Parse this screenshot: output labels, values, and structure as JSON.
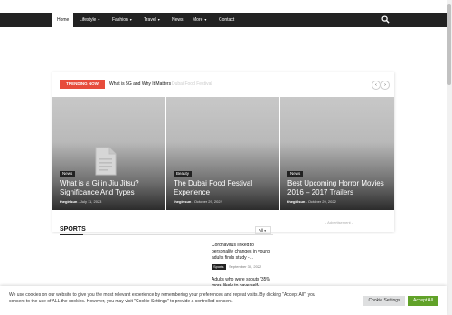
{
  "nav": {
    "items": [
      {
        "label": "Home",
        "caret": ""
      },
      {
        "label": "Lifestyle",
        "caret": "▾"
      },
      {
        "label": "Fashion",
        "caret": "▾"
      },
      {
        "label": "Travel",
        "caret": "▾"
      },
      {
        "label": "News",
        "caret": ""
      },
      {
        "label": "More",
        "caret": "▾"
      },
      {
        "label": "Contact",
        "caret": ""
      }
    ],
    "search_icon": "search-icon"
  },
  "trending": {
    "label": "TRENDING NOW",
    "headline": "What is 5G and Why It Matters",
    "fading": "Dubai Food Festival",
    "prev": "‹",
    "next": "›"
  },
  "slides": [
    {
      "category": "News",
      "title": "What is a Gi in Jiu Jitsu? Significance And Types",
      "author": "thegirlsun",
      "date": "July 11, 2023"
    },
    {
      "category": "Beauty",
      "title": "The Dubai Food Festival Experience",
      "author": "thegirlsun",
      "date": "October 29, 2022"
    },
    {
      "category": "News",
      "title": "Best Upcoming Horror Movies 2016 – 2017 Trailers",
      "author": "thegirlsun",
      "date": "October 29, 2022"
    }
  ],
  "sports": {
    "title": "SPORTS",
    "filter": "All",
    "advertisement": "- Advertisement -",
    "items": [
      {
        "title": "Coronavirus linked to personality changes in young adults finds study -...",
        "category": "Sports",
        "date": "September 30, 2022"
      },
      {
        "title": "Adults who were scouts '35% more likely to have self-",
        "category": "",
        "date": ""
      }
    ]
  },
  "cookie": {
    "text": "We use cookies on our website to give you the most relevant experience by remembering your preferences and repeat visits. By clicking \"Accept All\", you consent to the use of ALL the cookies. However, you may visit \"Cookie Settings\" to provide a controlled consent.",
    "settings_label": "Cookie Settings",
    "accept_label": "Accept All"
  },
  "colors": {
    "nav_bg": "#222222",
    "trending_red": "#e74c3c",
    "accept_green": "#61a229"
  }
}
